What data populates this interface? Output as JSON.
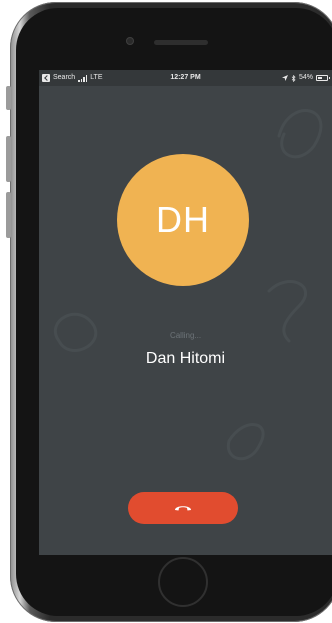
{
  "status_bar": {
    "back_app": "Search",
    "network": "LTE",
    "time": "12:27 PM",
    "battery": "54%",
    "battery_level": 0.54
  },
  "call": {
    "initials": "DH",
    "status": "Calling...",
    "name": "Dan Hitomi",
    "avatar_color": "#f0b352",
    "end_button_color": "#e14c2f",
    "background_color": "#3f4447"
  },
  "icons": {
    "back": "back-chevron-icon",
    "signal": "signal-bars-icon",
    "location": "location-arrow-icon",
    "bluetooth": "bluetooth-icon",
    "battery": "battery-icon",
    "end_call": "hang-up-icon"
  }
}
